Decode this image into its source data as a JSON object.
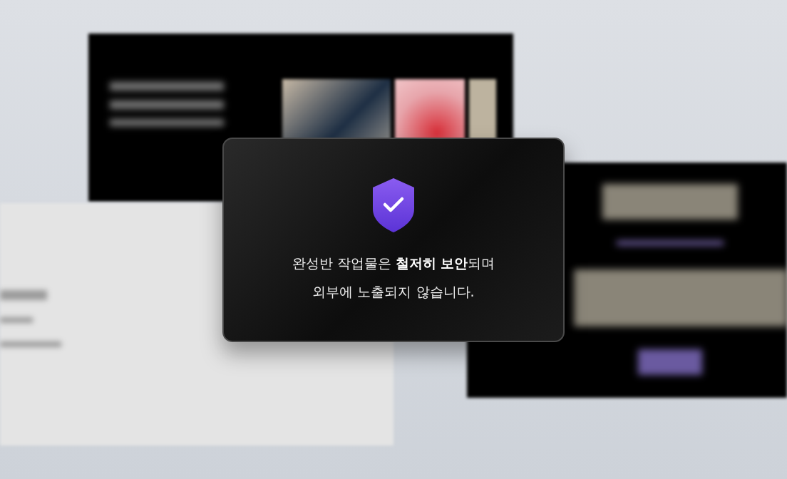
{
  "notice": {
    "message": "완성반 작업물은 **철저히 보안**되며\n외부에 노출되지 않습니다."
  }
}
